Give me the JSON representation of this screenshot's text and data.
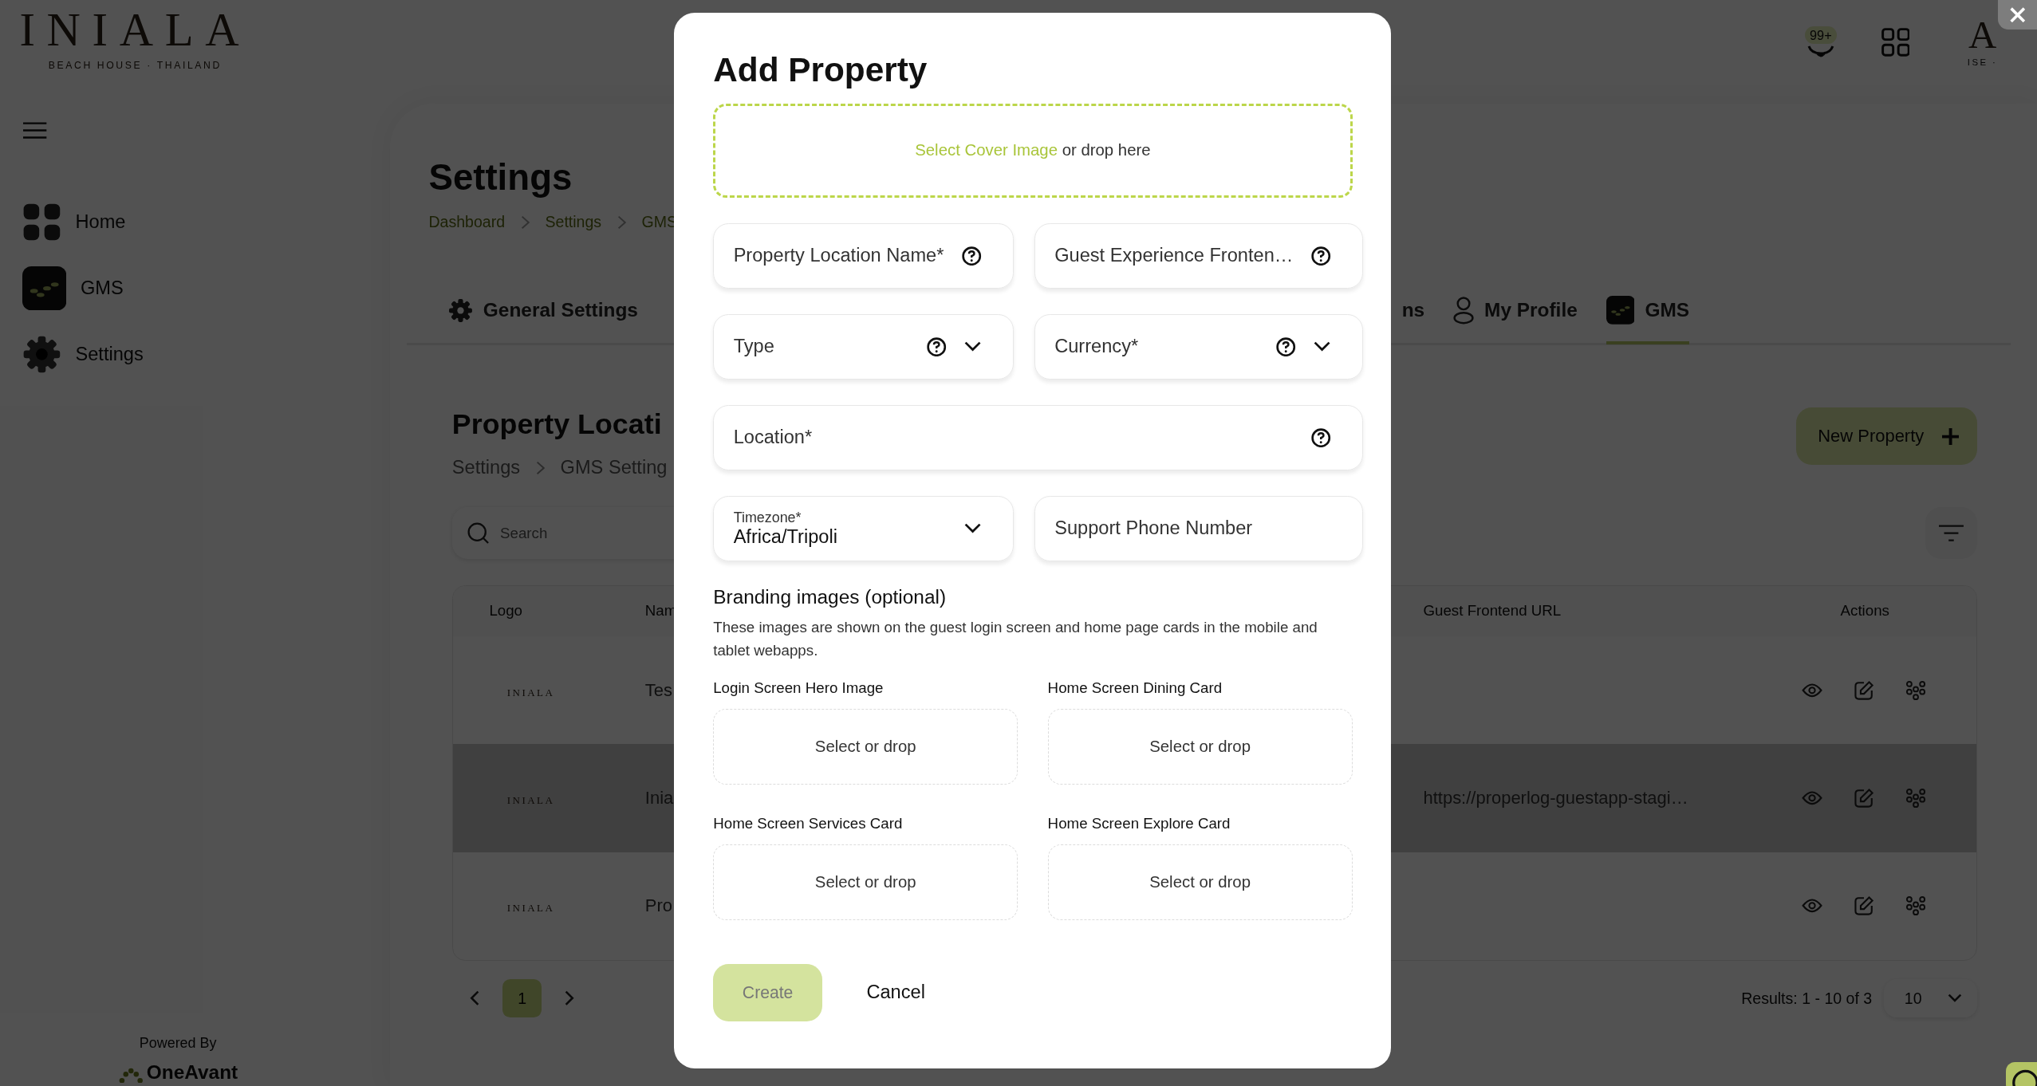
{
  "brand": {
    "name": "INIALA",
    "tagline": "BEACH HOUSE · THAILAND"
  },
  "header": {
    "badge": "99+",
    "account_letter": "A",
    "account_caption": "ISE ·"
  },
  "sidebar": {
    "items": [
      {
        "label": "Home",
        "kind": "home"
      },
      {
        "label": "GMS",
        "kind": "gms"
      },
      {
        "label": "Settings",
        "kind": "gear"
      }
    ],
    "powered_by": "Powered By",
    "vendor": "OneAvant"
  },
  "page": {
    "title": "Settings",
    "breadcrumb": [
      "Dashboard",
      "Settings",
      "GMS"
    ],
    "tabs": [
      {
        "label": "General Settings",
        "kind": "gear",
        "selected": false
      },
      {
        "label": "ns",
        "kind": "partial",
        "selected": false
      },
      {
        "label": "My Profile",
        "kind": "person",
        "selected": false
      },
      {
        "label": "GMS",
        "kind": "gms",
        "selected": true
      }
    ]
  },
  "section": {
    "title": "Property Locati",
    "breadcrumb": [
      "Settings",
      "GMS Setting"
    ],
    "search": {
      "placeholder": "Search"
    },
    "new_button": "New Property",
    "table": {
      "columns": [
        "Logo",
        "Nam",
        "Guest Frontend URL",
        "Actions"
      ],
      "rows": [
        {
          "logo": "INIALA",
          "name": "Tes",
          "selected": false
        },
        {
          "logo": "INIALA",
          "name": "Inia",
          "url": "https://properlog-guestapp-stagi…",
          "selected": true
        },
        {
          "logo": "INIALA",
          "name": "Pro",
          "selected": false
        }
      ]
    },
    "pagination": {
      "pages": [
        {
          "label": "1",
          "selected": true
        }
      ],
      "results": "Results: 1 - 10 of 3",
      "page_size": "10"
    }
  },
  "modal": {
    "title": "Add Property",
    "cover": {
      "link": "Select Cover Image",
      "text": "or drop here"
    },
    "fields": [
      {
        "label": "Property Location Name*",
        "kind": "text",
        "help": true,
        "wide": false
      },
      {
        "label": "Guest Experience Fronten…",
        "kind": "text",
        "help": true,
        "wide": false
      },
      {
        "label": "Type",
        "kind": "select",
        "help": true,
        "wide": false
      },
      {
        "label": "Currency*",
        "kind": "select",
        "help": true,
        "wide": false
      },
      {
        "label": "Location*",
        "kind": "text",
        "help": true,
        "wide": true
      },
      {
        "label": "Timezone*",
        "kind": "select",
        "value": "Africa/Tripoli",
        "help": false,
        "wide": false
      },
      {
        "label": "Support Phone Number",
        "kind": "text",
        "help": false,
        "wide": false
      }
    ],
    "branding": {
      "title": "Branding images (optional)",
      "description": "These images are shown on the guest login screen and home page cards in the mobile and tablet webapps.",
      "slots": [
        {
          "label": "Login Screen Hero Image",
          "prompt": "Select or drop"
        },
        {
          "label": "Home Screen Dining Card",
          "prompt": "Select or drop"
        },
        {
          "label": "Home Screen Services Card",
          "prompt": "Select or drop"
        },
        {
          "label": "Home Screen Explore Card",
          "prompt": "Select or drop"
        }
      ]
    },
    "buttons": [
      {
        "label": "Create",
        "kind": "primary",
        "disabled": true
      },
      {
        "label": "Cancel",
        "kind": "text",
        "disabled": false
      }
    ]
  }
}
